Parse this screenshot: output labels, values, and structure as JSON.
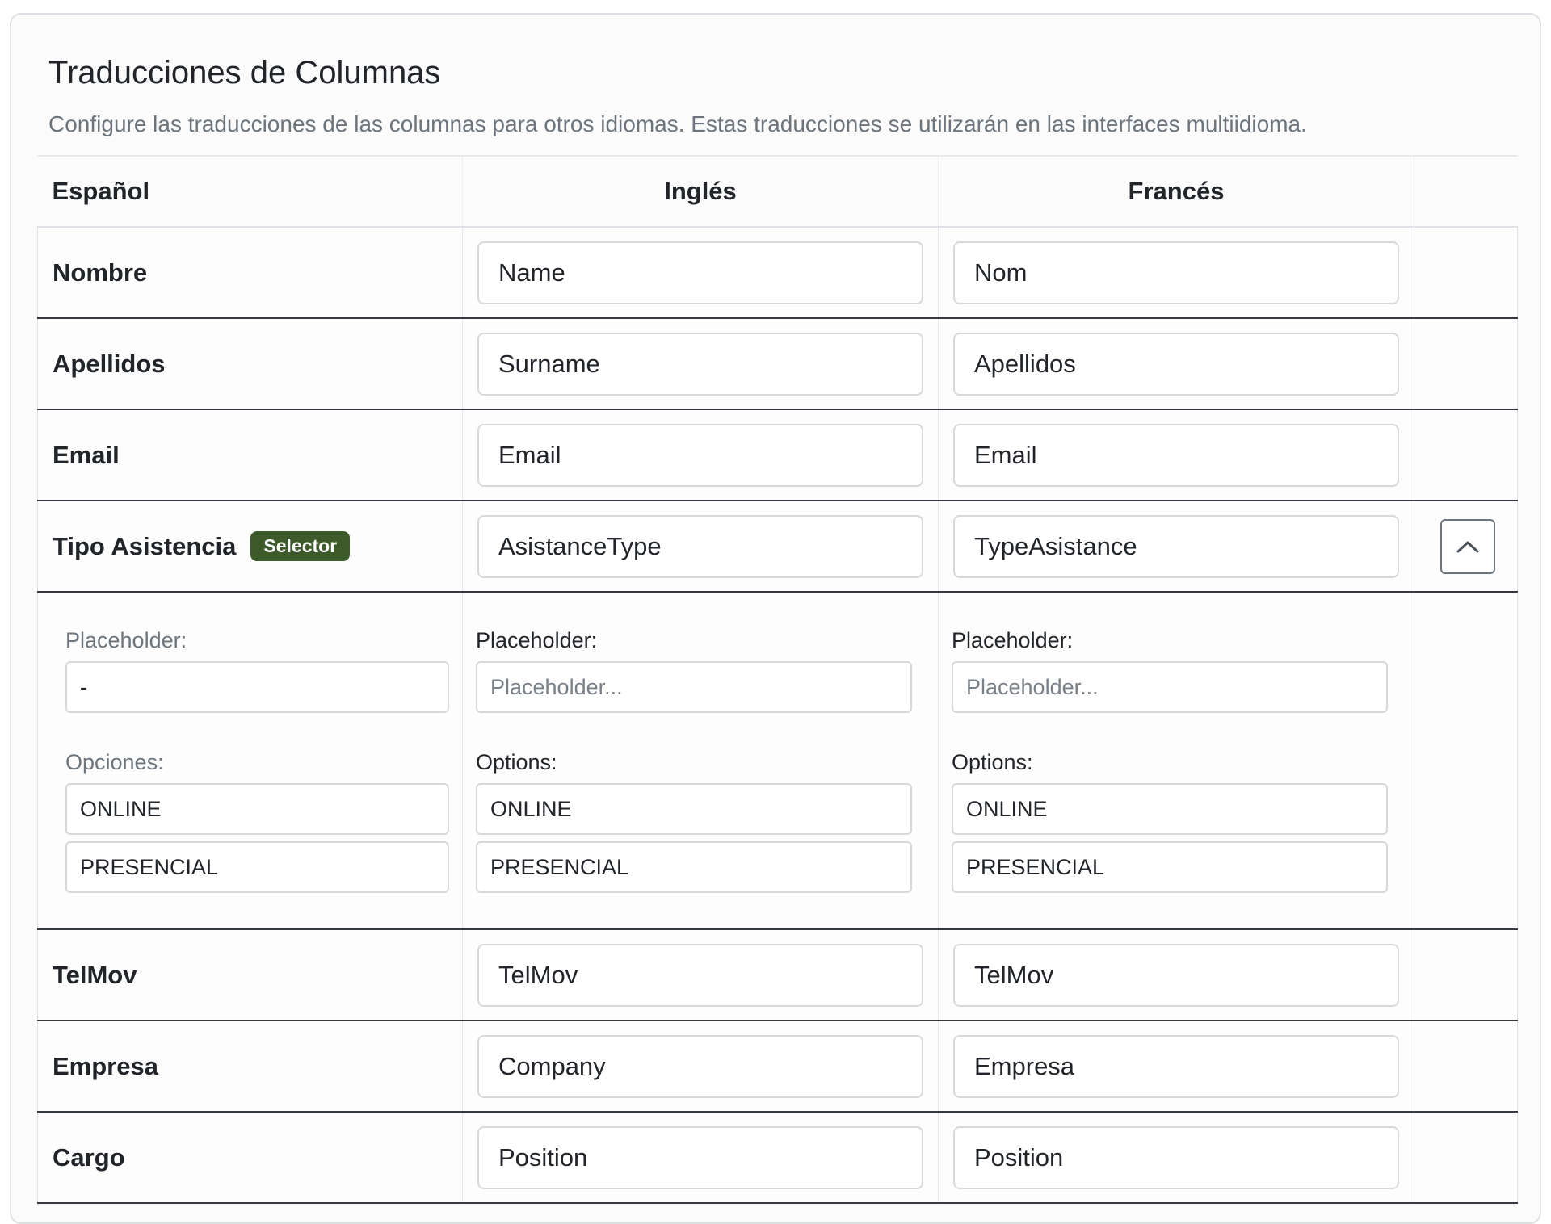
{
  "header": {
    "title": "Traducciones de Columnas",
    "subtitle": "Configure las traducciones de las columnas para otros idiomas. Estas traducciones se utilizarán en las interfaces multiidioma."
  },
  "table": {
    "headers": [
      "Español",
      "Inglés",
      "Francés"
    ],
    "rows": [
      {
        "es": "Nombre",
        "en": "Name",
        "fr": "Nom"
      },
      {
        "es": "Apellidos",
        "en": "Surname",
        "fr": "Apellidos"
      },
      {
        "es": "Email",
        "en": "Email",
        "fr": "Email"
      },
      {
        "es": "Tipo Asistencia",
        "badge": "Selector",
        "en": "AsistanceType",
        "fr": "TypeAsistance"
      },
      {
        "es": "TelMov",
        "en": "TelMov",
        "fr": "TelMov"
      },
      {
        "es": "Empresa",
        "en": "Company",
        "fr": "Empresa"
      },
      {
        "es": "Cargo",
        "en": "Position",
        "fr": "Position"
      }
    ],
    "detail": {
      "es": {
        "placeholder_label": "Placeholder:",
        "placeholder_value": "-",
        "options_label": "Opciones:",
        "options": [
          "ONLINE",
          "PRESENCIAL"
        ]
      },
      "en": {
        "placeholder_label": "Placeholder:",
        "placeholder_hint": "Placeholder...",
        "options_label": "Options:",
        "options": [
          "ONLINE",
          "PRESENCIAL"
        ]
      },
      "fr": {
        "placeholder_label": "Placeholder:",
        "placeholder_hint": "Placeholder...",
        "options_label": "Options:",
        "options": [
          "ONLINE",
          "PRESENCIAL"
        ]
      }
    },
    "collapse_icon": "chevron-up-icon"
  },
  "colors": {
    "badge_bg": "#3d5a2a",
    "row_border": "#343a40",
    "muted_text": "#6c757d"
  }
}
